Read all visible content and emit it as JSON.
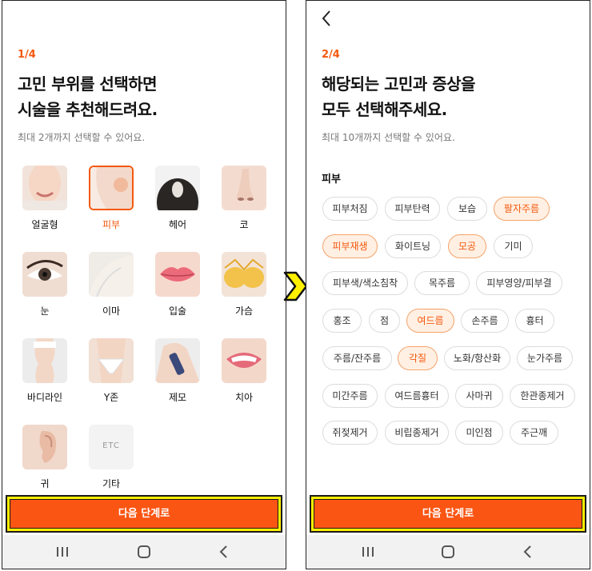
{
  "screen1": {
    "step": "1/4",
    "title_line1": "고민 부위를 선택하면",
    "title_line2": "시술을 추천해드려요.",
    "subtitle": "최대 2개까지 선택할 수 있어요.",
    "areas": [
      {
        "label": "얼굴형",
        "selected": false
      },
      {
        "label": "피부",
        "selected": true
      },
      {
        "label": "헤어",
        "selected": false
      },
      {
        "label": "코",
        "selected": false
      },
      {
        "label": "눈",
        "selected": false
      },
      {
        "label": "이마",
        "selected": false
      },
      {
        "label": "입술",
        "selected": false
      },
      {
        "label": "가슴",
        "selected": false
      },
      {
        "label": "바디라인",
        "selected": false
      },
      {
        "label": "Y존",
        "selected": false
      },
      {
        "label": "제모",
        "selected": false
      },
      {
        "label": "치아",
        "selected": false
      },
      {
        "label": "귀",
        "selected": false
      },
      {
        "label": "기타",
        "selected": false
      }
    ],
    "etc_thumb_text": "ETC",
    "next_button": "다음 단계로"
  },
  "screen2": {
    "step": "2/4",
    "title_line1": "해당되는 고민과 증상을",
    "title_line2": "모두 선택해주세요.",
    "subtitle": "최대 10개까지 선택할 수 있어요.",
    "section": "피부",
    "symptoms": [
      {
        "label": "피부처짐",
        "selected": false
      },
      {
        "label": "피부탄력",
        "selected": false
      },
      {
        "label": "보습",
        "selected": false
      },
      {
        "label": "팔자주름",
        "selected": true
      },
      {
        "label": "피부재생",
        "selected": true
      },
      {
        "label": "화이트닝",
        "selected": false
      },
      {
        "label": "모공",
        "selected": true
      },
      {
        "label": "기미",
        "selected": false
      },
      {
        "label": "피부색/색소침착",
        "selected": false
      },
      {
        "label": "목주름",
        "selected": false
      },
      {
        "label": "피부영양/피부결",
        "selected": false
      },
      {
        "label": "홍조",
        "selected": false
      },
      {
        "label": "점",
        "selected": false
      },
      {
        "label": "여드름",
        "selected": true
      },
      {
        "label": "손주름",
        "selected": false
      },
      {
        "label": "흉터",
        "selected": false
      },
      {
        "label": "주름/잔주름",
        "selected": false
      },
      {
        "label": "각질",
        "selected": true
      },
      {
        "label": "노화/항산화",
        "selected": false
      },
      {
        "label": "눈가주름",
        "selected": false
      },
      {
        "label": "미간주름",
        "selected": false
      },
      {
        "label": "여드름흉터",
        "selected": false
      },
      {
        "label": "사마귀",
        "selected": false
      },
      {
        "label": "한관종제거",
        "selected": false
      },
      {
        "label": "쥐젖제거",
        "selected": false
      },
      {
        "label": "비립종제거",
        "selected": false
      },
      {
        "label": "미인점",
        "selected": false
      },
      {
        "label": "주근깨",
        "selected": false
      }
    ],
    "next_button": "다음 단계로"
  },
  "navbar": {
    "icons": [
      "recent-apps-icon",
      "home-icon",
      "back-icon"
    ]
  },
  "colors": {
    "accent": "#f4590f",
    "button": "#fa5513",
    "highlight": "#ffef00",
    "chip_selected_bg": "#fff0e3"
  }
}
